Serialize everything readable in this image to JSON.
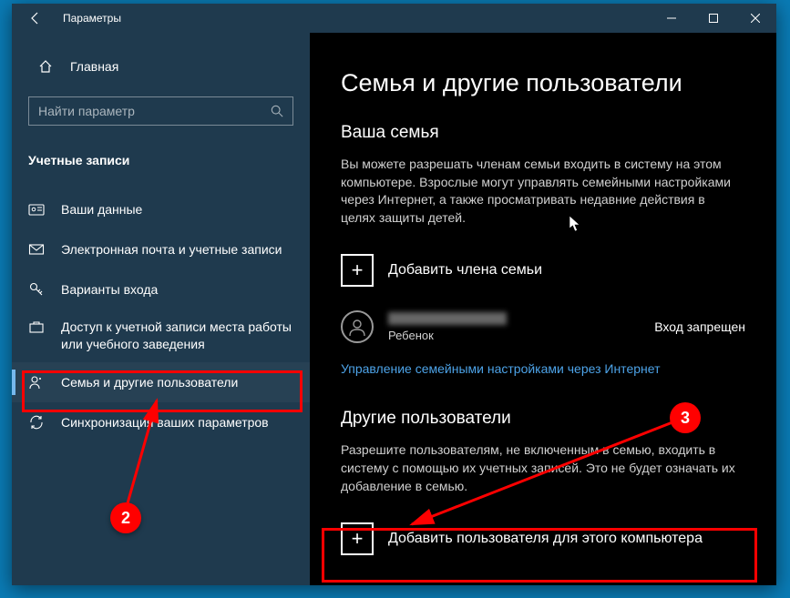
{
  "window": {
    "title": "Параметры"
  },
  "sidebar": {
    "home_label": "Главная",
    "search_placeholder": "Найти параметр",
    "section": "Учетные записи",
    "items": [
      {
        "label": "Ваши данные",
        "icon": "id-card"
      },
      {
        "label": "Электронная почта и учетные записи",
        "icon": "mail"
      },
      {
        "label": "Варианты входа",
        "icon": "key"
      },
      {
        "label": "Доступ к учетной записи места работы или учебного заведения",
        "icon": "briefcase"
      },
      {
        "label": "Семья и другие пользователи",
        "icon": "people",
        "active": true
      },
      {
        "label": "Синхронизация ваших параметров",
        "icon": "sync"
      }
    ]
  },
  "main": {
    "heading": "Семья и другие пользователи",
    "family": {
      "heading": "Ваша семья",
      "desc": "Вы можете разрешать членам семьи входить в систему на этом компьютере. Взрослые могут управлять семейными настройками через Интернет, а также просматривать недавние действия в целях защиты детей.",
      "add_label": "Добавить члена семьи",
      "member_role": "Ребенок",
      "member_status": "Вход запрещен",
      "manage_link": "Управление семейными настройками через Интернет"
    },
    "others": {
      "heading": "Другие пользователи",
      "desc": "Разрешите пользователям, не включенным в семью, входить в систему с помощью их учетных записей. Это не будет означать их добавление в семью.",
      "add_label": "Добавить пользователя для этого компьютера"
    }
  },
  "annotations": {
    "step2": "2",
    "step3": "3"
  }
}
